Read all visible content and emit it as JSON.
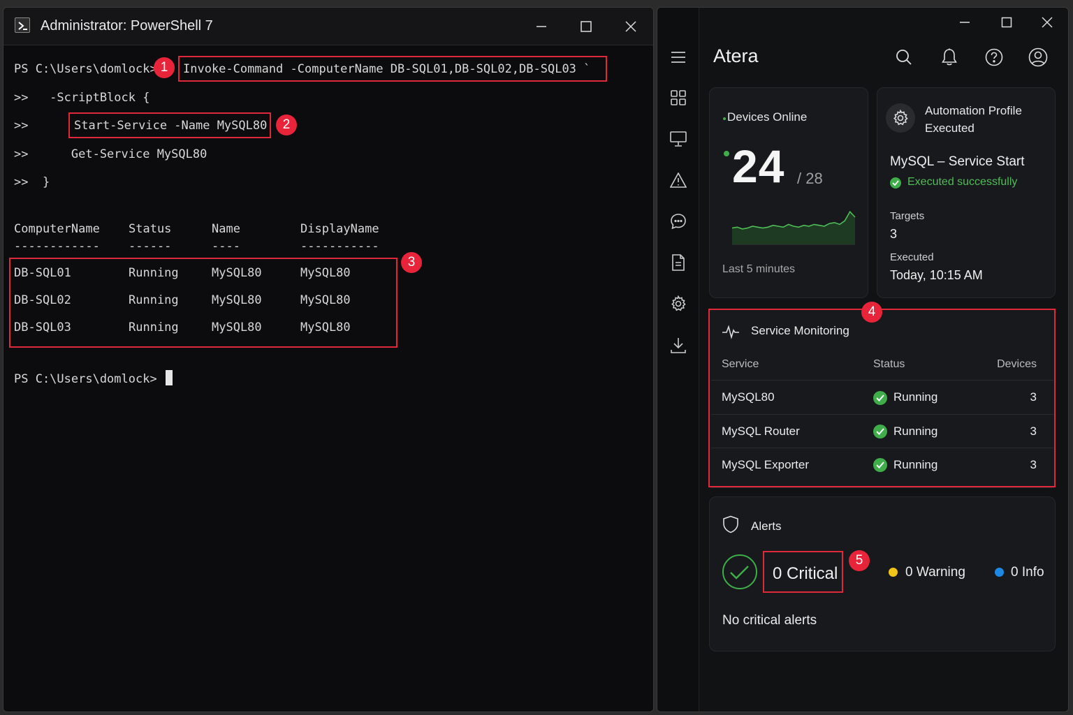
{
  "powershell": {
    "title": "Administrator: PowerShell 7",
    "lines": {
      "l1_prompt": "PS C:\\Users\\domlock>",
      "l1_cmd": "Invoke-Command -ComputerName DB-SQL01,DB-SQL02,DB-SQL03 `",
      "l2": ">>   -ScriptBlock {",
      "l3_prefix": ">>",
      "l3_cmd": "Start-Service -Name MySQL80",
      "l4": ">>      Get-Service MySQL80",
      "l5": ">>  }"
    },
    "table": {
      "headers": [
        "ComputerName",
        "Status",
        "Name",
        "DisplayName"
      ],
      "underlines": [
        "------------",
        "------",
        "----",
        "-----------"
      ],
      "rows": [
        [
          "DB-SQL01",
          "Running",
          "MySQL80",
          "MySQL80"
        ],
        [
          "DB-SQL02",
          "Running",
          "MySQL80",
          "MySQL80"
        ],
        [
          "DB-SQL03",
          "Running",
          "MySQL80",
          "MySQL80"
        ]
      ]
    },
    "final_prompt": "PS C:\\Users\\domlock>"
  },
  "annotations": [
    "1",
    "2",
    "3",
    "4",
    "5"
  ],
  "atera": {
    "title": "Atera",
    "devices": {
      "label": "Devices Online",
      "count": "24",
      "total": "/ 28",
      "caption": "Last 5 minutes",
      "sparkline": [
        18,
        19,
        17,
        18,
        20,
        19,
        18,
        19,
        21,
        20,
        19,
        22,
        20,
        19,
        21,
        20,
        22,
        21,
        20,
        23,
        24,
        22,
        26,
        36,
        30
      ]
    },
    "automation": {
      "title_line1": "Automation Profile",
      "title_line2": "Executed",
      "profile": "MySQL – Service Start",
      "status": "Executed successfully",
      "targets_label": "Targets",
      "targets_value": "3",
      "executed_label": "Executed",
      "executed_value": "Today, 10:15 AM"
    },
    "monitoring": {
      "title": "Service Monitoring",
      "col_service": "Service",
      "col_status": "Status",
      "col_devices": "Devices",
      "rows": [
        {
          "service": "MySQL80",
          "status": "Running",
          "devices": "3"
        },
        {
          "service": "MySQL Router",
          "status": "Running",
          "devices": "3"
        },
        {
          "service": "MySQL Exporter",
          "status": "Running",
          "devices": "3"
        }
      ]
    },
    "alerts": {
      "title": "Alerts",
      "critical": "0 Critical",
      "warning": "0 Warning",
      "info": "0 Info",
      "message": "No critical alerts"
    },
    "colors": {
      "accent_red": "#e0283b",
      "success_green": "#3fae4a",
      "warning_yellow": "#f2c417",
      "info_blue": "#1e88e5"
    }
  }
}
